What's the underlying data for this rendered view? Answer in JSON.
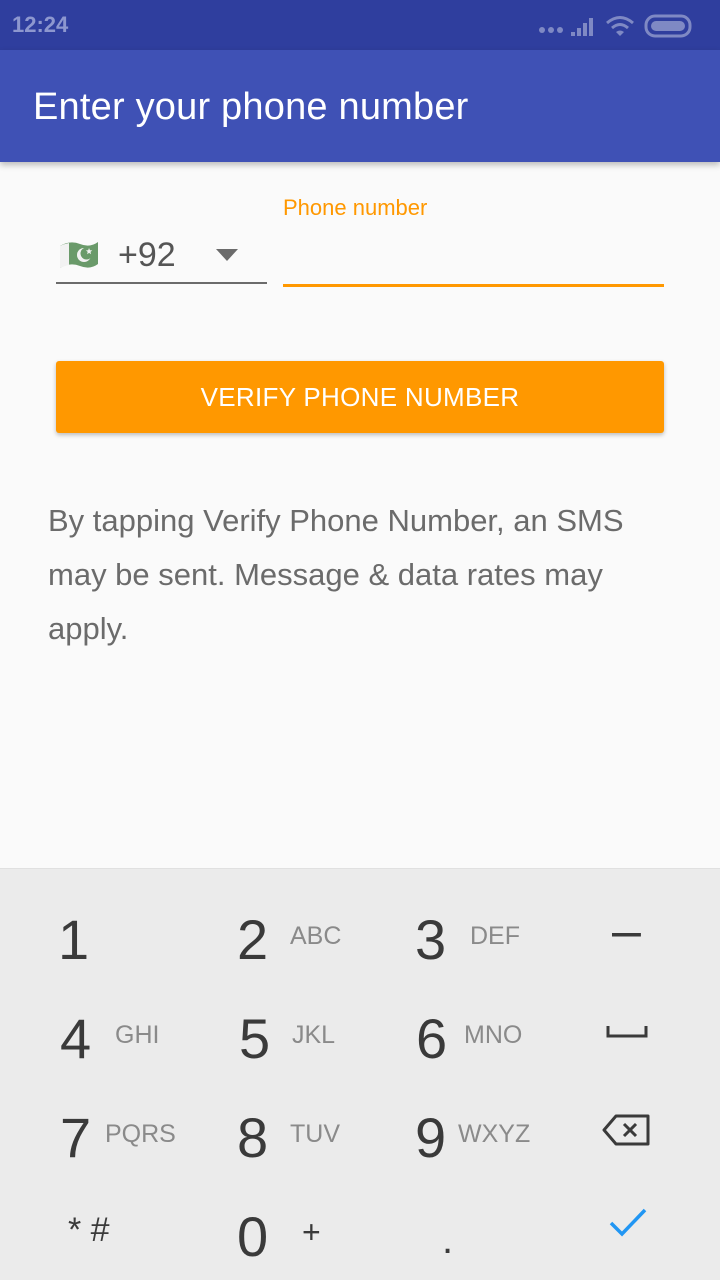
{
  "status_bar": {
    "time": "12:24"
  },
  "app_bar": {
    "title": "Enter your phone number"
  },
  "country_picker": {
    "code": "+92",
    "flag": "pakistan-flag"
  },
  "phone_field": {
    "label": "Phone number",
    "value": "",
    "placeholder": ""
  },
  "verify_button": {
    "label": "VERIFY PHONE NUMBER"
  },
  "disclaimer": "By tapping Verify Phone Number, an SMS may be sent. Message & data rates may apply.",
  "keypad": {
    "keys": [
      {
        "digit": "1",
        "letters": ""
      },
      {
        "digit": "2",
        "letters": "ABC"
      },
      {
        "digit": "3",
        "letters": "DEF"
      },
      {
        "digit": "4",
        "letters": "GHI"
      },
      {
        "digit": "5",
        "letters": "JKL"
      },
      {
        "digit": "6",
        "letters": "MNO"
      },
      {
        "digit": "7",
        "letters": "PQRS"
      },
      {
        "digit": "8",
        "letters": "TUV"
      },
      {
        "digit": "9",
        "letters": "WXYZ"
      },
      {
        "digit": "0",
        "letters": "+"
      }
    ],
    "symbols": {
      "dash": "–",
      "star_hash": "* #",
      "dot": "."
    }
  },
  "colors": {
    "status_bar": "#2f3e9e",
    "app_bar": "#3f51b5",
    "accent": "#ff9800",
    "check": "#2196f3"
  }
}
